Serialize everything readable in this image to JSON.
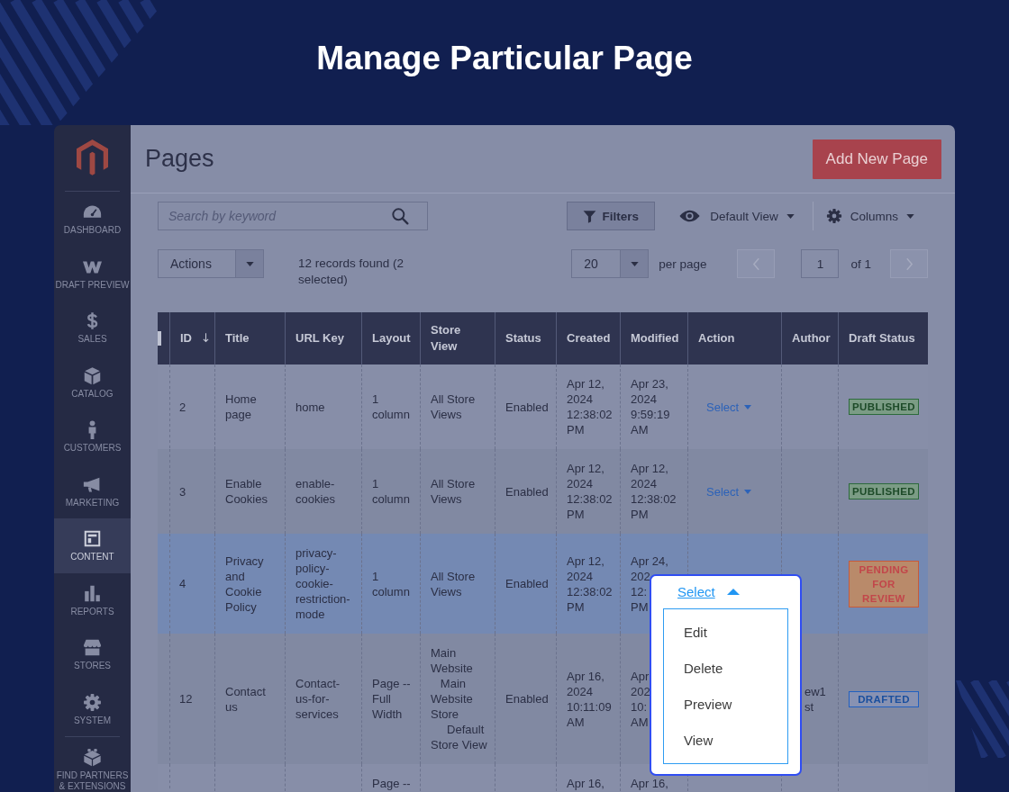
{
  "heading": "Manage Particular Page",
  "sidebar": {
    "items": [
      {
        "label": "DASHBOARD",
        "selected": false
      },
      {
        "label": "DRAFT PREVIEW",
        "selected": false
      },
      {
        "label": "SALES",
        "selected": false
      },
      {
        "label": "CATALOG",
        "selected": false
      },
      {
        "label": "CUSTOMERS",
        "selected": false
      },
      {
        "label": "MARKETING",
        "selected": false
      },
      {
        "label": "CONTENT",
        "selected": true
      },
      {
        "label": "REPORTS",
        "selected": false
      },
      {
        "label": "STORES",
        "selected": false
      },
      {
        "label": "SYSTEM",
        "selected": false
      },
      {
        "label": "FIND PARTNERS\n& EXTENSIONS",
        "selected": false
      }
    ]
  },
  "page": {
    "title": "Pages",
    "add_button": "Add New Page"
  },
  "toolbar": {
    "search": {
      "placeholder": "Search by keyword"
    },
    "filters": "Filters",
    "view": "Default View",
    "columns": "Columns"
  },
  "listing": {
    "actions": "Actions",
    "records": "12 records found (2 selected)",
    "per_page": {
      "value": "20",
      "label": "per page"
    },
    "pagination": {
      "previous": {
        "disabled": true
      },
      "page": "1",
      "total": "of 1",
      "next": {
        "disabled": true
      }
    }
  },
  "table": {
    "header_checkbox": {
      "checked": false
    },
    "columns": [
      {
        "label": "ID",
        "sorted": true
      },
      {
        "label": "Title",
        "sorted": false
      },
      {
        "label": "URL Key",
        "sorted": false
      },
      {
        "label": "Layout",
        "sorted": false
      },
      {
        "label": "Store\nView",
        "sorted": false
      },
      {
        "label": "Status",
        "sorted": false
      },
      {
        "label": "Created",
        "sorted": false
      },
      {
        "label": "Modified",
        "sorted": false
      },
      {
        "label": "Action",
        "sorted": false
      },
      {
        "label": "Author",
        "sorted": false
      },
      {
        "label": "Draft Status",
        "sorted": false
      }
    ],
    "rows": [
      {
        "selected": false,
        "id": "2",
        "title": "Home\npage",
        "url_key": "home",
        "layout": "1\ncolumn",
        "store_view": "All Store\nViews",
        "status": "Enabled",
        "created": "Apr 12,\n2024\n12:38:02\nPM",
        "modified": "Apr 23,\n2024\n9:59:19\nAM",
        "action": {
          "label": "Select",
          "expanded": false
        },
        "draft_status": {
          "label": "PUBLISHED",
          "kind": "published"
        }
      },
      {
        "selected": false,
        "id": "3",
        "title": "Enable\nCookies",
        "url_key": "enable-\ncookies",
        "layout": "1\ncolumn",
        "store_view": "All Store\nViews",
        "status": "Enabled",
        "created": "Apr 12,\n2024\n12:38:02\nPM",
        "modified": "Apr 12,\n2024\n12:38:02\nPM",
        "action": {
          "label": "Select",
          "expanded": false
        },
        "draft_status": {
          "label": "PUBLISHED",
          "kind": "published"
        }
      },
      {
        "selected": true,
        "id": "4",
        "title": "Privacy\nand\nCookie\nPolicy",
        "url_key": "privacy-\npolicy-\ncookie-\nrestriction-\nmode",
        "layout": "1\ncolumn",
        "store_view": "All Store\nViews",
        "status": "Enabled",
        "created": "Apr 12,\n2024\n12:38:02\nPM",
        "modified": "Apr 24,\n202\n12:\nPM",
        "action": {
          "label": "Select",
          "expanded": true,
          "items": [
            "Edit",
            "Delete",
            "Preview",
            "View"
          ]
        },
        "draft_status": {
          "label": "PENDING\nFOR\nREVIEW",
          "kind": "pending"
        }
      },
      {
        "selected": false,
        "id": "12",
        "title": "Contact\nus",
        "url_key": "Contact-\nus-for-\nservices",
        "layout": "Page --\nFull\nWidth",
        "store_view": "Main\nWebsite\n   Main\nWebsite\nStore\n     Default\nStore View",
        "status": "Enabled",
        "created": "Apr 16,\n2024\n10:11:09\nAM",
        "modified": "Apr\n202\n10:\nAM",
        "author": "ew1\nst",
        "draft_status": {
          "label": "DRAFTED",
          "kind": "drafted"
        }
      },
      {
        "selected": false,
        "layout": "Page --",
        "created": "Apr 16,",
        "modified": "Apr 16,"
      }
    ]
  }
}
